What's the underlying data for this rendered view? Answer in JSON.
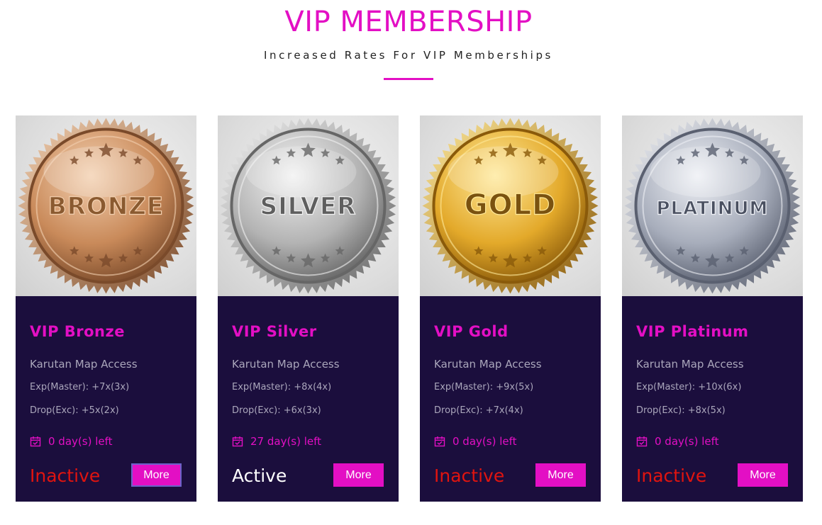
{
  "header": {
    "title": "VIP MEMBERSHIP",
    "subtitle": "Increased Rates For VIP Memberships"
  },
  "cards": [
    {
      "medal_text": "BRONZE",
      "title": "VIP Bronze",
      "perk_main": "Karutan Map Access",
      "perk_exp": "Exp(Master): +7x(3x)",
      "perk_drop": "Drop(Exc): +5x(2x)",
      "days": "0 day(s) left",
      "status": "Inactive",
      "button": "More",
      "colors": {
        "light": "#f3d0b0",
        "mid": "#c98a5a",
        "dark": "#7a4a2a",
        "text": "#8a5a30"
      }
    },
    {
      "medal_text": "SILVER",
      "title": "VIP Silver",
      "perk_main": "Karutan Map Access",
      "perk_exp": "Exp(Master): +8x(4x)",
      "perk_drop": "Drop(Exc): +6x(3x)",
      "days": "27 day(s) left",
      "status": "Active",
      "button": "More",
      "colors": {
        "light": "#f2f2f2",
        "mid": "#b3b3b3",
        "dark": "#666666",
        "text": "#5e5e5e"
      }
    },
    {
      "medal_text": "GOLD",
      "title": "VIP Gold",
      "perk_main": "Karutan Map Access",
      "perk_exp": "Exp(Master): +9x(5x)",
      "perk_drop": "Drop(Exc): +7x(4x)",
      "days": "0 day(s) left",
      "status": "Inactive",
      "button": "More",
      "colors": {
        "light": "#ffe99a",
        "mid": "#e3a92a",
        "dark": "#8a5a0a",
        "text": "#7a5210"
      }
    },
    {
      "medal_text": "PLATINUM",
      "title": "VIP Platinum",
      "perk_main": "Karutan Map Access",
      "perk_exp": "Exp(Master): +10x(6x)",
      "perk_drop": "Drop(Exc): +8x(5x)",
      "days": "0 day(s) left",
      "status": "Inactive",
      "button": "More",
      "colors": {
        "light": "#eef0f5",
        "mid": "#a7adbb",
        "dark": "#5a6070",
        "text": "#4a5060"
      }
    }
  ],
  "theme": {
    "accent": "#e30fc4",
    "card_bg": "#1b0e3d",
    "inactive": "#e0140f",
    "active": "#ffffff"
  }
}
